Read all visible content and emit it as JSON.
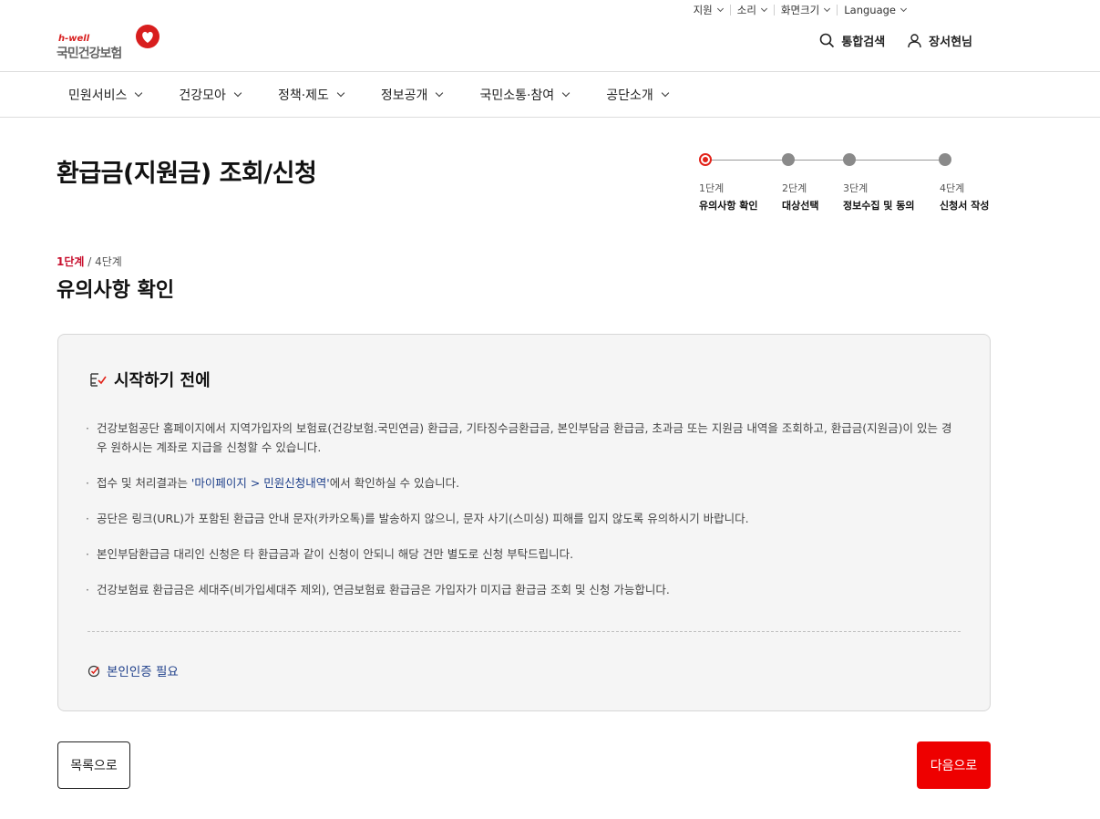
{
  "utility": {
    "items": [
      {
        "label": "지원"
      },
      {
        "label": "소리"
      },
      {
        "label": "화면크기"
      },
      {
        "label": "Language"
      }
    ]
  },
  "header": {
    "logo_hwell": "h-well",
    "logo_name": "국민건강보험",
    "search_label": "통합검색",
    "user_label": "장서현님"
  },
  "gnb": {
    "items": [
      {
        "label": "민원서비스"
      },
      {
        "label": "건강모아"
      },
      {
        "label": "정책·제도"
      },
      {
        "label": "정보공개"
      },
      {
        "label": "국민소통·참여"
      },
      {
        "label": "공단소개"
      }
    ]
  },
  "page": {
    "title": "환급금(지원금) 조회/신청"
  },
  "stepper": {
    "steps": [
      {
        "num": "1단계",
        "name": "유의사항 확인",
        "active": true
      },
      {
        "num": "2단계",
        "name": "대상선택",
        "active": false
      },
      {
        "num": "3단계",
        "name": "정보수집 및 동의",
        "active": false
      },
      {
        "num": "4단계",
        "name": "신청서 작성",
        "active": false
      }
    ]
  },
  "step_indicator": {
    "current": "1단계",
    "separator": " / ",
    "total": "4단계"
  },
  "section": {
    "title": "유의사항 확인"
  },
  "notice": {
    "heading": "시작하기 전에",
    "items": [
      {
        "text": "건강보험공단 홈페이지에서 지역가입자의 보험료(건강보험.국민연금) 환급금, 기타징수금환급금, 본인부담금 환급금, 초과금 또는 지원금 내역을 조회하고, 환급금(지원금)이 있는 경우 원하시는 계좌로 지급을 신청할 수 있습니다."
      },
      {
        "pre": "접수 및 처리결과는 ",
        "highlight": "'마이페이지 > 민원신청내역'",
        "post": "에서 확인하실 수 있습니다."
      },
      {
        "text": "공단은 링크(URL)가 포함된 환급금 안내 문자(카카오톡)를 발송하지 않으니, 문자 사기(스미싱) 피해를 입지 않도록 유의하시기 바랍니다."
      },
      {
        "text": "본인부담환급금 대리인 신청은 타 환급금과 같이 신청이 안되니 해당 건만 별도로 신청 부탁드립니다."
      },
      {
        "text": "건강보험료 환급금은 세대주(비가입세대주 제외), 연금보험료 환급금은 가입자가 미지급 환급금 조회 및 신청 가능합니다."
      }
    ],
    "auth_label": "본인인증 필요"
  },
  "buttons": {
    "list": "목록으로",
    "next": "다음으로"
  },
  "colors": {
    "accent": "#ee0000",
    "step_active": "#e2231a",
    "link_blue": "#1e3f8a"
  }
}
